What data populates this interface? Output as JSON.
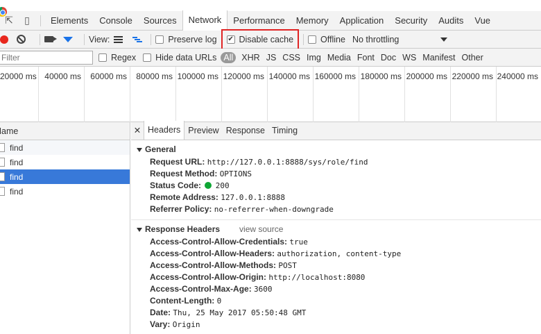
{
  "tabs": [
    "Elements",
    "Console",
    "Sources",
    "Network",
    "Performance",
    "Memory",
    "Application",
    "Security",
    "Audits",
    "Vue"
  ],
  "active_tab": "Network",
  "toolbar": {
    "view_label": "View:",
    "preserve_log": "Preserve log",
    "disable_cache": "Disable cache",
    "offline": "Offline",
    "throttling": "No throttling"
  },
  "filterbar": {
    "placeholder": "Filter",
    "regex": "Regex",
    "hide_data_urls": "Hide data URLs",
    "types": [
      "All",
      "XHR",
      "JS",
      "CSS",
      "Img",
      "Media",
      "Font",
      "Doc",
      "WS",
      "Manifest",
      "Other"
    ]
  },
  "timeline": {
    "ticks": [
      "20000 ms",
      "40000 ms",
      "60000 ms",
      "80000 ms",
      "100000 ms",
      "120000 ms",
      "140000 ms",
      "160000 ms",
      "180000 ms",
      "200000 ms",
      "220000 ms",
      "240000 ms"
    ]
  },
  "requests": {
    "header": "Name",
    "rows": [
      "find",
      "find",
      "find",
      "find"
    ],
    "selected_index": 2
  },
  "details": {
    "close": "✕",
    "tabs": [
      "Headers",
      "Preview",
      "Response",
      "Timing"
    ],
    "general": {
      "title": "General",
      "rows": [
        {
          "key": "Request URL:",
          "value": "http://127.0.0.1:8888/sys/role/find"
        },
        {
          "key": "Request Method:",
          "value": "OPTIONS"
        },
        {
          "key": "Status Code:",
          "value": "200"
        },
        {
          "key": "Remote Address:",
          "value": "127.0.0.1:8888"
        },
        {
          "key": "Referrer Policy:",
          "value": "no-referrer-when-downgrade"
        }
      ]
    },
    "response_headers": {
      "title": "Response Headers",
      "view_source": "view source",
      "rows": [
        {
          "key": "Access-Control-Allow-Credentials:",
          "value": "true"
        },
        {
          "key": "Access-Control-Allow-Headers:",
          "value": "authorization, content-type"
        },
        {
          "key": "Access-Control-Allow-Methods:",
          "value": "POST"
        },
        {
          "key": "Access-Control-Allow-Origin:",
          "value": "http://localhost:8080"
        },
        {
          "key": "Access-Control-Max-Age:",
          "value": "3600"
        },
        {
          "key": "Content-Length:",
          "value": "0"
        },
        {
          "key": "Date:",
          "value": "Thu, 25 May 2017 05:50:48 GMT"
        },
        {
          "key": "Vary:",
          "value": "Origin"
        }
      ]
    }
  },
  "colors": {
    "record": "#e8271d",
    "selected_row": "#3879d9",
    "status_ok": "#0ea634",
    "highlight_box": "#e02424",
    "filter_icon": "#1a73e8"
  }
}
